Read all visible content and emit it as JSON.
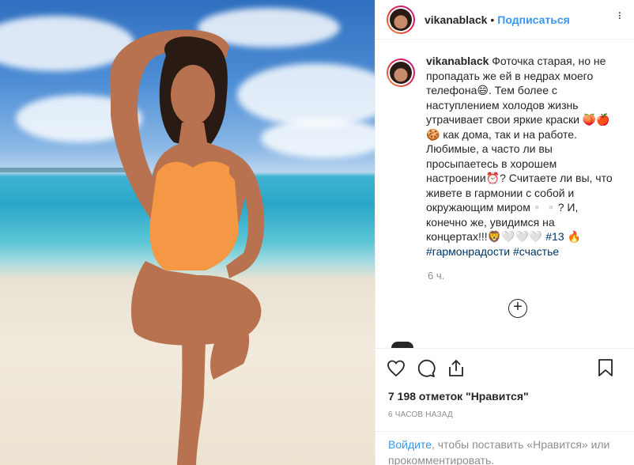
{
  "header": {
    "username": "vikanablack",
    "separator": "•",
    "follow_label": "Подписаться",
    "more": "..."
  },
  "caption": {
    "username": "vikanablack",
    "text": "Фоточка старая, но не пропадать же ей в недрах моего телефона😄. Тем более с наступлением холодов жизнь утрачивает свои яркие краски 🍑🍎 🍪 как дома, так и на работе. Любимые, а часто ли вы просыпаетесь в хорошем настроении⏰? Считаете ли вы, что живете в гармонии с собой и окружающим миром▫️▫️? И, конечно же, увидимся на концертах!!!🦁🤍🤍🤍",
    "tags": [
      "#13",
      "#гармонрадости",
      "#счастье"
    ],
    "time": "6 ч."
  },
  "add_comment_icon": "plus-circle-icon",
  "actions": {
    "icons": [
      "heart-icon",
      "comment-icon",
      "share-icon",
      "bookmark-icon"
    ],
    "likes": "7 198 отметок \"Нравится\"",
    "posted": "6 ЧАСОВ НАЗАД"
  },
  "login": {
    "link": "Войдите",
    "text": ", чтобы поставить «Нравится» или прокомментировать."
  },
  "colors": {
    "link": "#3897f0",
    "hashtag": "#003569",
    "muted": "#8e8e8e"
  }
}
